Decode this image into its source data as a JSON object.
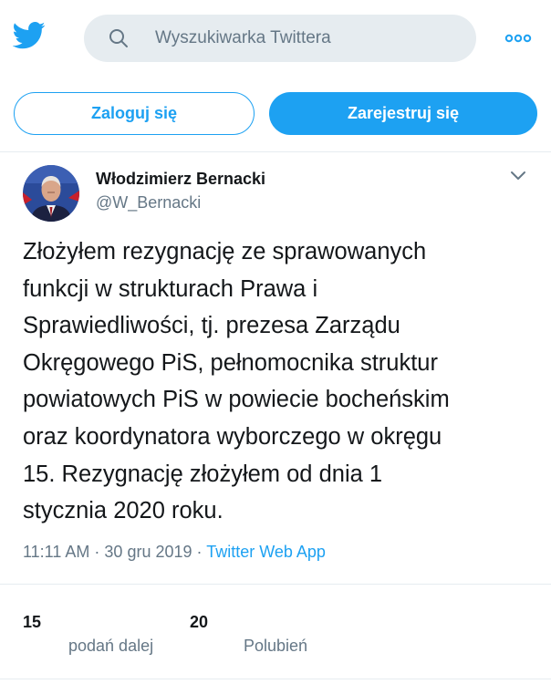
{
  "header": {
    "logo_icon": "twitter-bird-icon",
    "search": {
      "placeholder": "Wyszukiwarka Twittera",
      "icon": "search-icon"
    },
    "more_icon": "more-dots-icon"
  },
  "auth": {
    "login_label": "Zaloguj się",
    "signup_label": "Zarejestruj się"
  },
  "tweet": {
    "author": {
      "name": "Włodzimierz Bernacki",
      "handle": "@W_Bernacki"
    },
    "text": "Złożyłem rezygnację ze sprawowanych\nfunkcji w strukturach Prawa i\nSprawiedliwości, tj.  prezesa Zarządu\nOkręgowego PiS, pełnomocnika struktur\npowiatowych PiS w powiecie bocheńskim\noraz koordynatora wyborczego w okręgu\n15. Rezygnację złożyłem od dnia 1\nstycznia 2020 roku.",
    "time": "11:11 AM",
    "separator": "·",
    "date": "30 gru 2019",
    "source": "Twitter Web App",
    "retweets": {
      "count": "15",
      "label": "podań dalej"
    },
    "likes": {
      "count": "20",
      "label": "Polubień"
    }
  },
  "colors": {
    "accent": "#1da1f2",
    "text": "#14171a",
    "secondary": "#657786",
    "search_bg": "#e6ecf0"
  }
}
